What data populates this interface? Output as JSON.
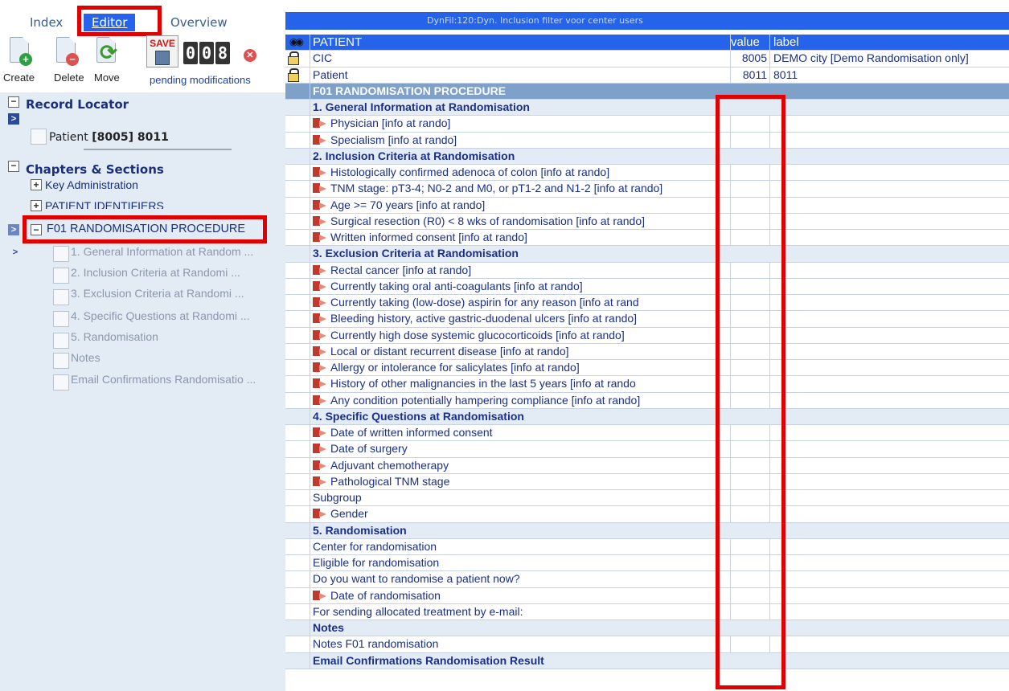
{
  "tabs": {
    "index": "Index",
    "editor": "Editor",
    "overview": "Overview"
  },
  "toolbar": {
    "create": "Create",
    "delete": "Delete",
    "move": "Move",
    "save_text": "SAVE",
    "counter": [
      "0",
      "0",
      "8"
    ],
    "pending": "pending modifications"
  },
  "locator": {
    "title": "Record Locator",
    "patient_label": "Patient",
    "patient_value": "[8005] 8011"
  },
  "chapters": {
    "title": "Chapters & Sections",
    "items": [
      "Key Administration",
      "PATIENT IDENTIFIERS",
      "F01 RANDOMISATION PROCEDURE"
    ],
    "subitems": [
      "1. General Information at Random ...",
      "2. Inclusion Criteria at Randomi ...",
      "3. Exclusion Criteria at Randomi ...",
      "4. Specific Questions at Randomi ...",
      "5. Randomisation",
      "Notes",
      "Email Confirmations Randomisatio ..."
    ]
  },
  "filter_title": "DynFil:120:Dyn. Inclusion filter voor center users",
  "grid": {
    "col_patient": "PATIENT",
    "col_value": "value",
    "col_label": "label",
    "rows": [
      {
        "type": "locked",
        "label": "CIC",
        "value": "8005",
        "text": "DEMO city [Demo Randomisation only]"
      },
      {
        "type": "locked",
        "label": "Patient",
        "value": "8011",
        "text": "8011"
      },
      {
        "type": "chapter",
        "label": "F01 RANDOMISATION PROCEDURE"
      },
      {
        "type": "header",
        "label": "1. General Information at Randomisation"
      },
      {
        "type": "field",
        "flag": true,
        "label": "Physician [info at rando]"
      },
      {
        "type": "field",
        "flag": true,
        "label": "Specialism [info at rando]"
      },
      {
        "type": "header",
        "label": "2. Inclusion Criteria at Randomisation"
      },
      {
        "type": "field",
        "flag": true,
        "label": "Histologically confirmed adenoca of colon [info at rando]"
      },
      {
        "type": "field",
        "flag": true,
        "label": "TNM stage: pT3-4; N0-2 and M0, or pT1-2 and N1-2 [info at rando]"
      },
      {
        "type": "field",
        "flag": true,
        "label": "Age >= 70 years [info at rando]"
      },
      {
        "type": "field",
        "flag": true,
        "label": "Surgical resection (R0) < 8 wks of randomisation [info at rando]"
      },
      {
        "type": "field",
        "flag": true,
        "label": "Written informed consent [info at rando]"
      },
      {
        "type": "header",
        "label": "3. Exclusion Criteria at Randomisation"
      },
      {
        "type": "field",
        "flag": true,
        "label": "Rectal cancer [info at rando]"
      },
      {
        "type": "field",
        "flag": true,
        "label": "Currently taking oral anti-coagulants [info at rando]"
      },
      {
        "type": "field",
        "flag": true,
        "label": "Currently taking (low-dose) aspirin for any reason [info at rand"
      },
      {
        "type": "field",
        "flag": true,
        "label": "Bleeding history, active gastric-duodenal ulcers [info at rando]"
      },
      {
        "type": "field",
        "flag": true,
        "label": "Currently high dose systemic glucocorticoids [info at rando]"
      },
      {
        "type": "field",
        "flag": true,
        "label": "Local or distant recurrent disease [info at rando]"
      },
      {
        "type": "field",
        "flag": true,
        "label": "Allergy or intolerance for salicylates [info at rando]"
      },
      {
        "type": "field",
        "flag": true,
        "label": "History of other malignancies in the last 5 years [info at rando"
      },
      {
        "type": "field",
        "flag": true,
        "label": "Any condition potentially hampering compliance [info at rando]"
      },
      {
        "type": "header",
        "label": "4. Specific Questions at Randomisation"
      },
      {
        "type": "field",
        "flag": true,
        "label": "Date of written informed consent"
      },
      {
        "type": "field",
        "flag": true,
        "label": "Date of surgery"
      },
      {
        "type": "field",
        "flag": true,
        "label": "Adjuvant chemotherapy"
      },
      {
        "type": "field",
        "flag": true,
        "label": "Pathological TNM stage"
      },
      {
        "type": "field",
        "flag": false,
        "label": "Subgroup"
      },
      {
        "type": "field",
        "flag": true,
        "label": "Gender"
      },
      {
        "type": "header",
        "label": "5. Randomisation"
      },
      {
        "type": "field",
        "flag": false,
        "label": "Center for randomisation"
      },
      {
        "type": "field",
        "flag": false,
        "label": "Eligible for randomisation"
      },
      {
        "type": "field",
        "flag": false,
        "label": "Do you want to randomise a patient now?"
      },
      {
        "type": "field",
        "flag": true,
        "label": "Date of randomisation"
      },
      {
        "type": "field",
        "flag": false,
        "label": "For sending allocated treatment by e-mail:"
      },
      {
        "type": "header",
        "label": "Notes"
      },
      {
        "type": "field",
        "flag": false,
        "label": "Notes F01 randomisation"
      },
      {
        "type": "header",
        "label": "Email Confirmations Randomisation Result"
      }
    ]
  },
  "colors": {
    "accent": "#2563eb",
    "panel": "#e3ebf5",
    "highlight": "#e00000",
    "chapter_row": "#7fa0c8"
  }
}
